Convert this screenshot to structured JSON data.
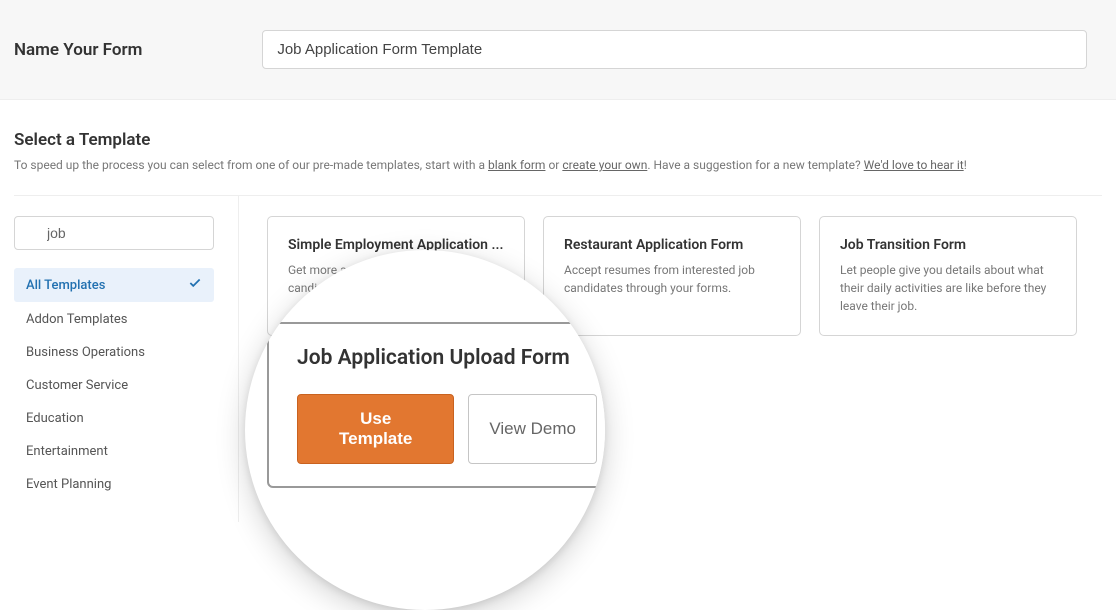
{
  "header": {
    "label": "Name Your Form",
    "input_value": "Job Application Form Template"
  },
  "section": {
    "title": "Select a Template",
    "subtitle_prefix": "To speed up the process you can select from one of our pre-made templates, start with a ",
    "link_blank": "blank form",
    "subtitle_or": " or ",
    "link_create": "create your own",
    "subtitle_mid": ". Have a suggestion for a new template? ",
    "link_feedback": "We'd love to hear it",
    "subtitle_end": "!"
  },
  "search": {
    "value": "job"
  },
  "filters": [
    {
      "label": "All Templates",
      "active": true
    },
    {
      "label": "Addon Templates",
      "active": false
    },
    {
      "label": "Business Operations",
      "active": false
    },
    {
      "label": "Customer Service",
      "active": false
    },
    {
      "label": "Education",
      "active": false
    },
    {
      "label": "Entertainment",
      "active": false
    },
    {
      "label": "Event Planning",
      "active": false
    }
  ],
  "cards": [
    {
      "title": "Simple Employment Application ...",
      "desc": "Get more applications from qualified candidates with file uploads."
    },
    {
      "title": "Restaurant Application Form",
      "desc": "Accept resumes from interested job candidates through your forms."
    },
    {
      "title": "Job Transition Form",
      "desc": "Let people give you details about what their daily activities are like before they leave their job."
    }
  ],
  "magnified": {
    "title": "Job Application Upload Form",
    "use_template_label": "Use Template",
    "view_demo_label": "View Demo"
  }
}
